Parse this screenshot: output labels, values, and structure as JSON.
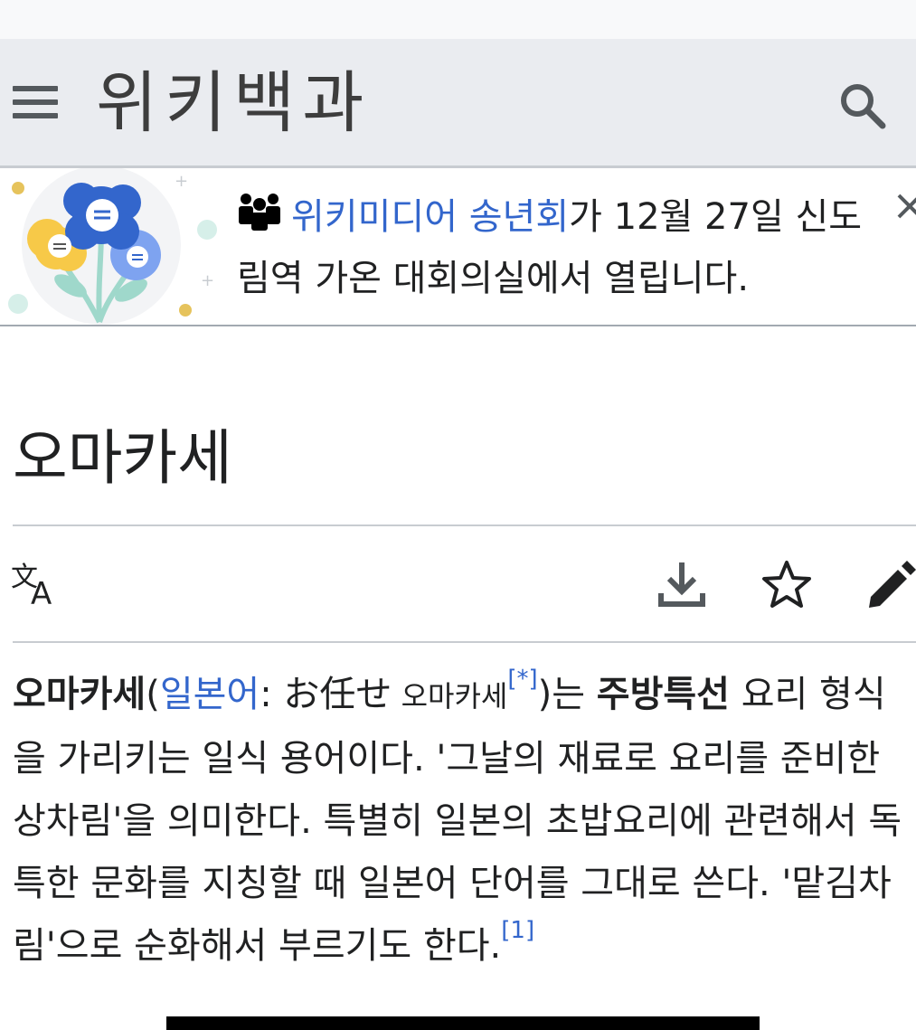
{
  "header": {
    "wordmark": "위키백과",
    "menu_icon": "hamburger-menu-icon",
    "search_icon": "search-icon"
  },
  "banner": {
    "icon": "people-group-icon",
    "link_text": "위키미디어 송년회",
    "text_after_link": "가 12월 27일 신도림역 가온 대회의실에서 열립니다.",
    "close_icon": "close-icon"
  },
  "page": {
    "title": "오마카세"
  },
  "page_actions": {
    "language_icon": "language-icon",
    "download_icon": "download-icon",
    "watch_icon": "star-icon",
    "edit_icon": "pencil-icon"
  },
  "article": {
    "bold_term": "오마카세",
    "paren_open": "(",
    "lang_link": "일본어",
    "colon": ": ",
    "japanese": "お任せ",
    "japanese_reading": " 오마카세",
    "note_ref": "[*]",
    "after_paren": ")는 ",
    "bold_phrase": "주방특선",
    "body": " 요리 형식을 가리키는 일식 용어이다. '그날의 재료로 요리를 준비한 상차림'을 의미한다. 특별히 일본의 초밥요리에 관련해서 독특한 문화를 지칭할 때 일본어 단어를 그대로 쓴다. '맡김차림'으로 순화해서 부르기도 한다.",
    "ref": "[1]"
  },
  "colors": {
    "link": "#3366cc",
    "header_bg": "#eaecf0",
    "text": "#202122",
    "icon": "#54595d"
  }
}
